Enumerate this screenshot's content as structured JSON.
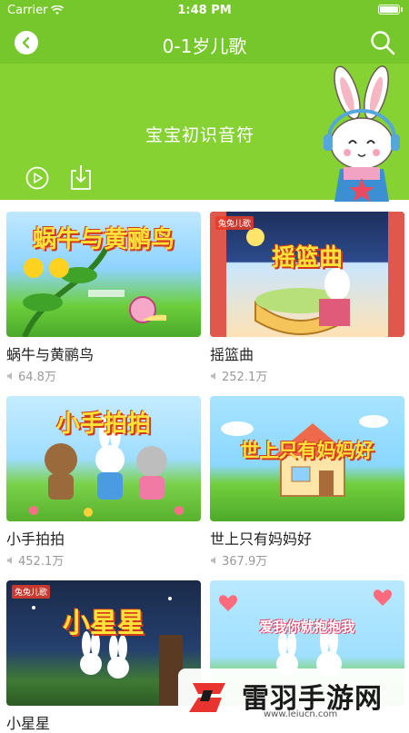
{
  "status_bar": {
    "carrier": "Carrier",
    "time": "1:48 PM"
  },
  "nav": {
    "title": "0-1岁儿歌"
  },
  "banner": {
    "text": "宝宝初识音符"
  },
  "videos": [
    {
      "title": "蜗牛与黄鹂鸟",
      "plays": "64.8万",
      "thumb_title": "蜗牛与黄鹂鸟",
      "brand": ""
    },
    {
      "title": "摇篮曲",
      "plays": "252.1万",
      "thumb_title": "摇篮曲",
      "brand": "兔兔儿歌"
    },
    {
      "title": "小手拍拍",
      "plays": "452.1万",
      "thumb_title": "小手拍拍",
      "brand": ""
    },
    {
      "title": "世上只有妈妈好",
      "plays": "367.9万",
      "thumb_title": "世上只有妈妈好",
      "brand": ""
    },
    {
      "title": "小星星",
      "plays": "",
      "thumb_title": "小星星",
      "brand": "兔兔儿歌"
    },
    {
      "title": "",
      "plays": "",
      "thumb_title": "爱我你就抱抱我",
      "brand": ""
    }
  ],
  "watermark": {
    "name": "雷羽手游网",
    "url": "www.leiucn.com"
  },
  "colors": {
    "nav": "#76c72b",
    "banner": "#86d233"
  }
}
